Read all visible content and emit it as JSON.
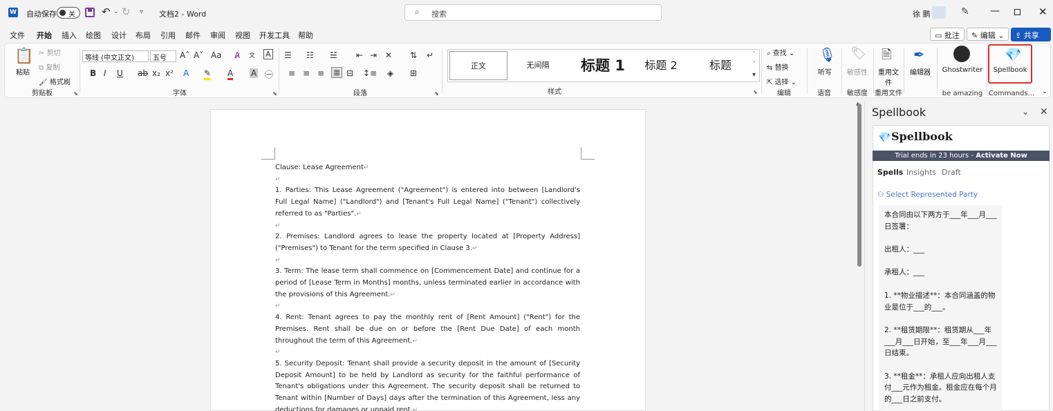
{
  "titlebar": {
    "app_logo": "W",
    "autosave_label": "自动保存",
    "autosave_state": "关",
    "doc_title": "文档2  -  Word",
    "search_placeholder": "搜索",
    "username": "徐 鹏"
  },
  "menu": {
    "tabs": [
      "文件",
      "开始",
      "插入",
      "绘图",
      "设计",
      "布局",
      "引用",
      "邮件",
      "审阅",
      "视图",
      "开发工具",
      "帮助"
    ],
    "active_tab": "开始",
    "comments_button": "批注",
    "editing_button": "编辑",
    "share_button": "共享"
  },
  "ribbon": {
    "clipboard": {
      "paste": "粘贴",
      "cut": "剪切",
      "copy": "复制",
      "format_painter": "格式刷",
      "label": "剪贴板"
    },
    "font": {
      "font_name": "等线 (中文正文)",
      "font_size": "五号",
      "label": "字体"
    },
    "paragraph": {
      "label": "段落"
    },
    "styles": {
      "items": [
        "正文",
        "无间隔",
        "标题 1",
        "标题 2",
        "标题"
      ],
      "label": "样式"
    },
    "editing": {
      "find": "查找",
      "replace": "替换",
      "select": "选择",
      "label": "编辑"
    },
    "voice": {
      "dictate": "听写",
      "label": "语音"
    },
    "sensitivity": {
      "button": "敏感性",
      "label": "敏感度"
    },
    "reuse": {
      "button": "重用文件",
      "label": "重用文件"
    },
    "editor": {
      "button": "编辑器"
    },
    "ghostwriter": {
      "button": "Ghostwriter",
      "label": "be amazing"
    },
    "spellbook": {
      "button": "Spellbook",
      "label": "Commands..."
    }
  },
  "document": {
    "paragraphs": [
      "Clause: Lease Agreement",
      "",
      "1. Parties: This Lease Agreement (\"Agreement\") is entered into between [Landlord's Full Legal Name] (\"Landlord\") and [Tenant's Full Legal Name] (\"Tenant\") collectively referred to as \"Parties\".",
      "",
      "2. Premises: Landlord agrees to lease the property located at [Property Address] (\"Premises\") to Tenant for the term specified in Clause 3.",
      "",
      "3. Term: The lease term shall commence on [Commencement Date] and continue for a period of [Lease Term in Months] months, unless terminated earlier in accordance with the provisions of this Agreement.",
      "",
      "4. Rent: Tenant agrees to pay the monthly rent of [Rent Amount] (\"Rent\") for the Premises. Rent shall be due on or before the [Rent Due Date] of each month throughout the term of this Agreement.",
      "",
      "5. Security Deposit: Tenant shall provide a security deposit in the amount of [Security Deposit Amount] to be held by Landlord as security for the faithful performance of Tenant's obligations under this Agreement. The security deposit shall be returned to Tenant within [Number of Days] days after the termination of this Agreement, less any deductions for damages or unpaid rent."
    ]
  },
  "pane": {
    "title": "Spellbook",
    "logo_text": "Spellbook",
    "trial_text": "Trial ends in 23 hours - ",
    "trial_link": "Activate Now",
    "tabs": [
      "Spells",
      "Insights",
      "Draft"
    ],
    "active_tab": "Spells",
    "party_link": "Select Represented Party",
    "content": [
      "本合同由以下两方于___年___月___日签署：",
      "",
      "出租人：___",
      "",
      "承租人：___",
      "",
      "1. **物业描述**：本合同涵盖的物业是位于___的___。",
      "",
      "2. **租赁期限**：租赁期从___年___月___日开始，至___年___月___日结束。",
      "",
      "3. **租金**：承租人应向出租人支付___元作为租金。租金应在每个月的___日之前支付。"
    ]
  },
  "colors": {
    "accent": "#185abd",
    "highlight_border": "#d9302a",
    "trial_bar": "#4a5266"
  }
}
